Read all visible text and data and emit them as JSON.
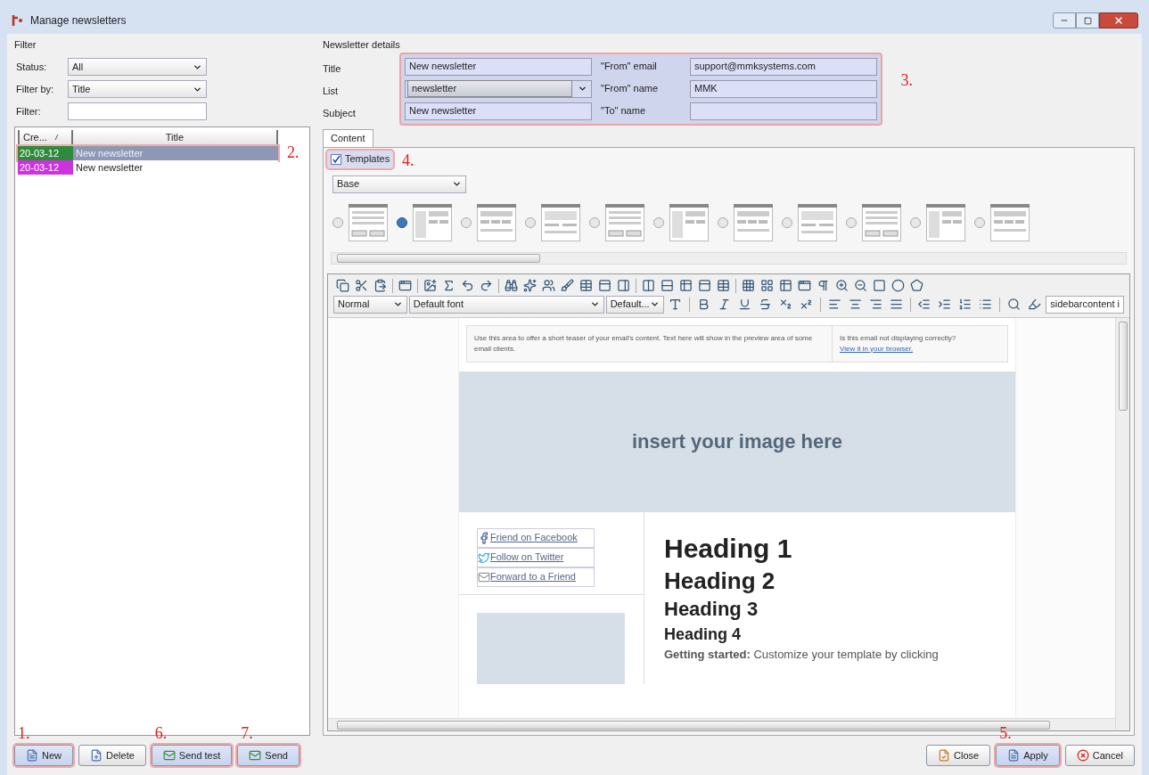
{
  "window": {
    "title": "Manage newsletters"
  },
  "filter": {
    "heading": "Filter",
    "fields": [
      {
        "label": "Status:",
        "kind": "select",
        "value": "All"
      },
      {
        "label": "Filter by:",
        "kind": "select",
        "value": "Title"
      },
      {
        "label": "Filter:",
        "kind": "text"
      }
    ]
  },
  "list": {
    "columns": [
      "Cre...",
      "Title"
    ],
    "rows": [
      {
        "created": "20-03-12",
        "color": "#2e8b3c",
        "title": "New newsletter",
        "selected": true,
        "highlighted": true,
        "annotation": "2."
      },
      {
        "created": "20-03-12",
        "color": "#cc33dd",
        "title": "New newsletter",
        "selected": false,
        "highlighted": false
      }
    ]
  },
  "details": {
    "heading": "Newsletter details",
    "annotation": "3.",
    "left": [
      {
        "label": "Title",
        "kind": "text",
        "value": "New newsletter"
      },
      {
        "label": "List",
        "kind": "select",
        "value": "newsletter"
      },
      {
        "label": "Subject",
        "kind": "text",
        "value": "New newsletter"
      }
    ],
    "right": [
      {
        "label": "\"From\" email",
        "value": "support@mmksystems.com"
      },
      {
        "label": "\"From\" name",
        "value": "MMK"
      },
      {
        "label": "\"To\" name"
      }
    ]
  },
  "tabs": [
    {
      "label": "Content",
      "selected": true
    }
  ],
  "templates": {
    "label": "Templates",
    "checked": true,
    "highlighted": true,
    "annotation": "4.",
    "set": "Base",
    "options": [
      {
        "selected": false
      },
      {
        "selected": true
      },
      {
        "selected": false
      },
      {
        "selected": false
      },
      {
        "selected": false
      },
      {
        "selected": false
      },
      {
        "selected": false
      },
      {
        "selected": false
      },
      {
        "selected": false
      },
      {
        "selected": false
      },
      {
        "selected": false
      }
    ]
  },
  "editor": {
    "style": "Normal",
    "font": "Default font",
    "size": "Default...",
    "class_field": "sidebarcontent i",
    "preheader": "Use this area to offer a short teaser of your email's content. Text here will show in the preview area of some email clients.",
    "view_note": "Is this email not displaying correctly?",
    "view_link": "View it in your browser.",
    "image_placeholder": "insert your image here",
    "social_links": [
      "Friend on Facebook",
      "Follow on Twitter",
      "Forward to a Friend"
    ],
    "headings": [
      "Heading 1",
      "Heading 2",
      "Heading 3",
      "Heading 4"
    ],
    "intro": "**Getting started:** Customize your template by clicking"
  },
  "buttons_left": [
    {
      "label": "New",
      "highlighted": true,
      "annotation": "1."
    },
    {
      "label": "Delete",
      "highlighted": false
    },
    {
      "label": "Send test",
      "highlighted": true,
      "annotation": "6."
    },
    {
      "label": "Send",
      "highlighted": true,
      "annotation": "7."
    }
  ],
  "buttons_right": [
    {
      "label": "Close",
      "highlighted": false
    },
    {
      "label": "Apply",
      "highlighted": true,
      "annotation": "5."
    },
    {
      "label": "Cancel",
      "highlighted": false
    }
  ]
}
